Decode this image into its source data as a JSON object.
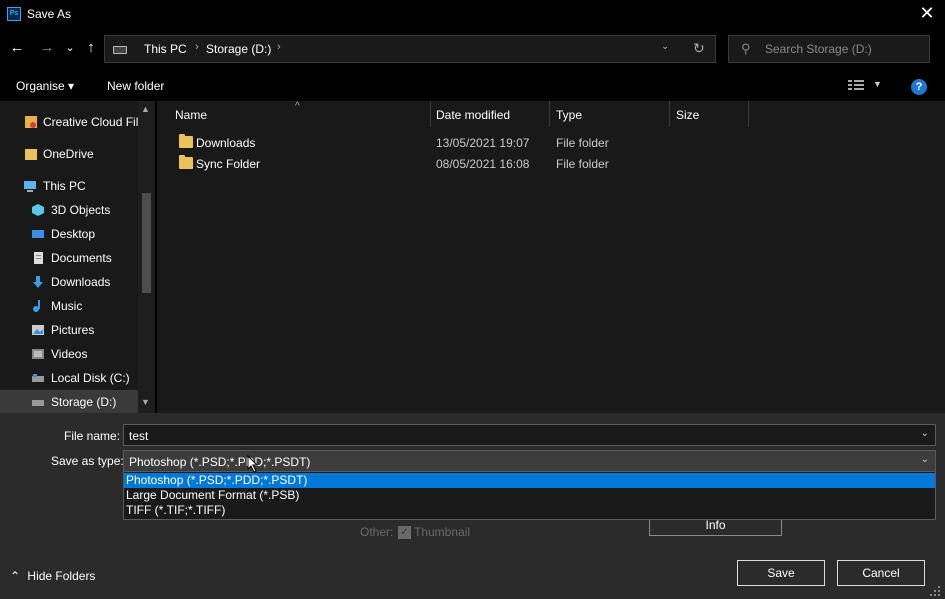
{
  "window": {
    "title": "Save As",
    "app_logo": "Ps",
    "close_glyph": "✕"
  },
  "nav": {
    "back_glyph": "←",
    "forward_glyph": "→",
    "recent_glyph": "⌄",
    "up_glyph": "↑"
  },
  "address": {
    "crumbs": [
      "This PC",
      "Storage (D:)"
    ],
    "separator": "›",
    "dropdown_glyph": "⌄",
    "refresh_glyph": "↻"
  },
  "search": {
    "placeholder": "Search Storage (D:)",
    "icon_glyph": "⚲"
  },
  "toolbar": {
    "organise": "Organise ▾",
    "new_folder": "New folder",
    "help": "?"
  },
  "sidebar": {
    "items": [
      {
        "label": "Creative Cloud Fil",
        "icon": "creative-cloud-icon"
      },
      {
        "label": "OneDrive",
        "icon": "onedrive-icon"
      },
      {
        "label": "This PC",
        "icon": "this-pc-icon"
      },
      {
        "label": "3D Objects",
        "icon": "3d-objects-icon"
      },
      {
        "label": "Desktop",
        "icon": "desktop-icon"
      },
      {
        "label": "Documents",
        "icon": "documents-icon"
      },
      {
        "label": "Downloads",
        "icon": "downloads-icon"
      },
      {
        "label": "Music",
        "icon": "music-icon"
      },
      {
        "label": "Pictures",
        "icon": "pictures-icon"
      },
      {
        "label": "Videos",
        "icon": "videos-icon"
      },
      {
        "label": "Local Disk (C:)",
        "icon": "local-disk-icon"
      },
      {
        "label": "Storage (D:)",
        "icon": "storage-drive-icon"
      }
    ],
    "scroll_up_glyph": "▲",
    "scroll_down_glyph": "▼"
  },
  "filelist": {
    "columns": [
      "Name",
      "Date modified",
      "Type",
      "Size"
    ],
    "sort_glyph": "^",
    "rows": [
      {
        "name": "Downloads",
        "date": "13/05/2021 19:07",
        "type": "File folder",
        "size": ""
      },
      {
        "name": "Sync Folder",
        "date": "08/05/2021 16:08",
        "type": "File folder",
        "size": ""
      }
    ]
  },
  "form": {
    "file_name_label": "File name:",
    "file_name_value": "test",
    "save_type_label": "Save as type:",
    "save_type_value": "Photoshop (*.PSD;*.PDD;*.PSDT)",
    "dropdown_glyph": "⌄",
    "type_options": [
      "Photoshop (*.PSD;*.PDD;*.PSDT)",
      "Large Document Format (*.PSB)",
      "TIFF (*.TIF;*.TIFF)"
    ],
    "selected_option_index": 0,
    "other_label": "Other:",
    "thumbnail_label": "Thumbnail",
    "thumbnail_checked": true,
    "check_glyph": "✓",
    "info_button": "Info"
  },
  "footer": {
    "hide_folders": "Hide Folders",
    "hide_glyph": "⌃",
    "save_button": "Save",
    "cancel_button": "Cancel"
  },
  "colors": {
    "selection": "#0078d7",
    "help": "#1e78d8",
    "folder": "#e8c25a"
  }
}
